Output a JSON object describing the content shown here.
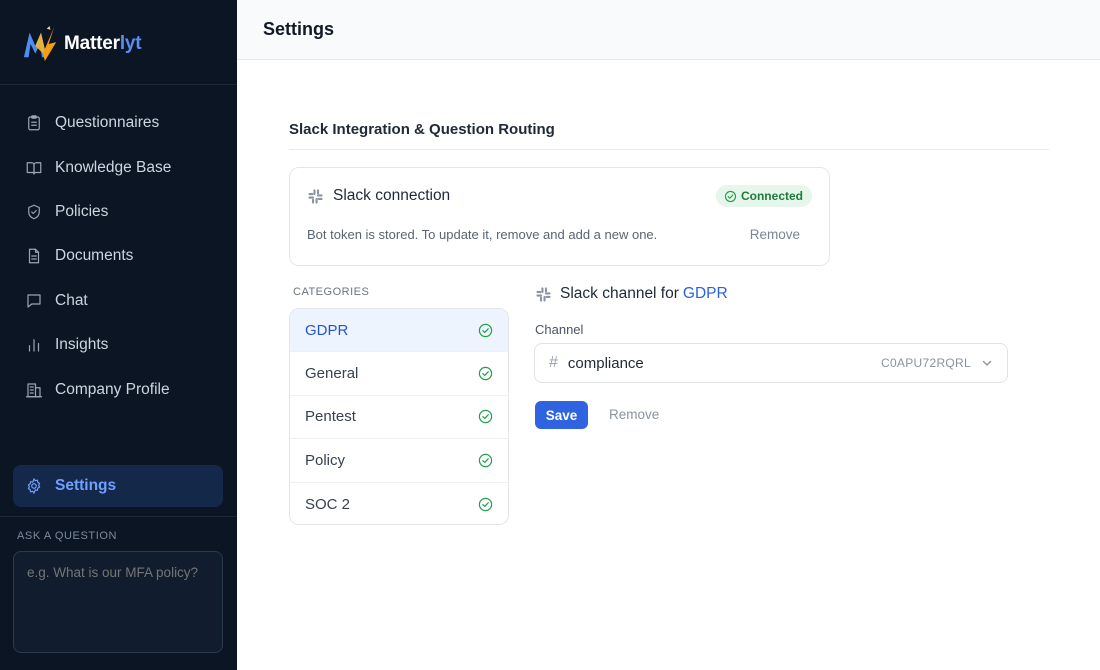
{
  "app": {
    "name_main": "Matter",
    "name_accent": "lyt"
  },
  "sidebar": {
    "items": [
      {
        "label": "Questionnaires",
        "icon": "clipboard-icon"
      },
      {
        "label": "Knowledge Base",
        "icon": "book-icon"
      },
      {
        "label": "Policies",
        "icon": "shield-icon"
      },
      {
        "label": "Documents",
        "icon": "document-icon"
      },
      {
        "label": "Chat",
        "icon": "chat-icon"
      },
      {
        "label": "Insights",
        "icon": "bar-chart-icon"
      },
      {
        "label": "Company Profile",
        "icon": "building-icon"
      }
    ],
    "active": {
      "label": "Settings",
      "icon": "gear-icon"
    },
    "ask": {
      "label": "ASK A QUESTION",
      "placeholder": "e.g. What is our MFA policy?"
    }
  },
  "header": {
    "title": "Settings"
  },
  "section": {
    "title": "Slack Integration & Question Routing"
  },
  "connection": {
    "title": "Slack connection",
    "status": "Connected",
    "description": "Bot token is stored. To update it, remove and add a new one.",
    "remove_label": "Remove"
  },
  "categories": {
    "label": "CATEGORIES",
    "items": [
      {
        "name": "GDPR",
        "active": true
      },
      {
        "name": "General",
        "active": false
      },
      {
        "name": "Pentest",
        "active": false
      },
      {
        "name": "Policy",
        "active": false
      },
      {
        "name": "SOC 2",
        "active": false
      }
    ]
  },
  "channel_panel": {
    "heading_prefix": "Slack channel for",
    "heading_category": "GDPR",
    "field_label": "Channel",
    "channel_name": "compliance",
    "channel_id": "C0APU72RQRL",
    "save_label": "Save",
    "remove_label": "Remove"
  },
  "colors": {
    "sidebar_bg": "#0b1524",
    "accent": "#2f63e0",
    "success": "#22a04b"
  }
}
